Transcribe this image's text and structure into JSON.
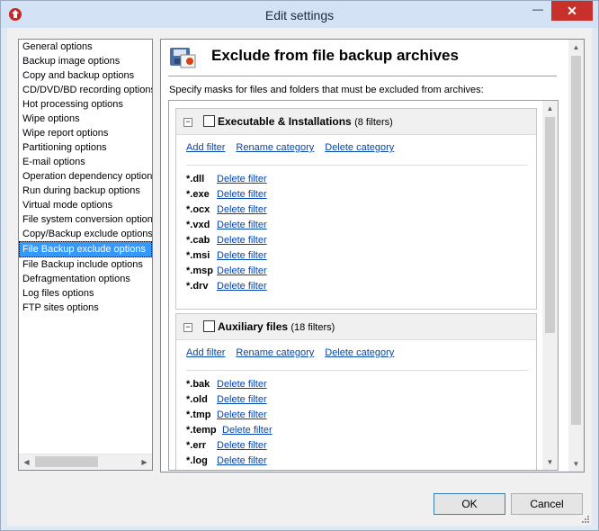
{
  "window": {
    "title": "Edit settings",
    "minimize_glyph": "—",
    "close_glyph": "✕"
  },
  "nav": {
    "items": [
      {
        "label": "General options"
      },
      {
        "label": "Backup image options"
      },
      {
        "label": "Copy and backup options"
      },
      {
        "label": "CD/DVD/BD recording options"
      },
      {
        "label": "Hot processing options"
      },
      {
        "label": "Wipe options"
      },
      {
        "label": "Wipe report options"
      },
      {
        "label": "Partitioning options"
      },
      {
        "label": "E-mail options"
      },
      {
        "label": "Operation dependency options"
      },
      {
        "label": "Run during backup options"
      },
      {
        "label": "Virtual mode options"
      },
      {
        "label": "File system conversion options"
      },
      {
        "label": "Copy/Backup exclude options"
      },
      {
        "label": "File Backup exclude options",
        "selected": true
      },
      {
        "label": "File Backup include options"
      },
      {
        "label": "Defragmentation options"
      },
      {
        "label": "Log files options"
      },
      {
        "label": "FTP sites options"
      }
    ]
  },
  "panel": {
    "title": "Exclude from file backup archives",
    "description": "Specify masks for  files and folders that must be excluded from archives:"
  },
  "groups": [
    {
      "name": "Executable & Installations",
      "count": "(8 filters)",
      "add_label": "Add filter",
      "rename_label": "Rename category",
      "delete_label": "Delete category",
      "filters": [
        {
          "mask": "*.dll",
          "delete": "Delete filter"
        },
        {
          "mask": "*.exe",
          "delete": "Delete filter"
        },
        {
          "mask": "*.ocx",
          "delete": "Delete filter"
        },
        {
          "mask": "*.vxd",
          "delete": "Delete filter"
        },
        {
          "mask": "*.cab",
          "delete": "Delete filter"
        },
        {
          "mask": "*.msi",
          "delete": "Delete filter"
        },
        {
          "mask": "*.msp",
          "delete": "Delete filter"
        },
        {
          "mask": "*.drv",
          "delete": "Delete filter"
        }
      ]
    },
    {
      "name": "Auxiliary files",
      "count": "(18 filters)",
      "add_label": "Add filter",
      "rename_label": "Rename category",
      "delete_label": "Delete category",
      "filters": [
        {
          "mask": "*.bak",
          "delete": "Delete filter"
        },
        {
          "mask": "*.old",
          "delete": "Delete filter"
        },
        {
          "mask": "*.tmp",
          "delete": "Delete filter"
        },
        {
          "mask": "*.temp",
          "delete": "Delete filter"
        },
        {
          "mask": "*.err",
          "delete": "Delete filter"
        },
        {
          "mask": "*.log",
          "delete": "Delete filter"
        }
      ]
    }
  ],
  "buttons": {
    "ok": "OK",
    "cancel": "Cancel"
  },
  "colors": {
    "selection": "#3399ff",
    "link": "#0645ad",
    "close": "#c7302b"
  },
  "icons": {
    "app": "app-logo-icon",
    "header": "file-backup-icon"
  }
}
